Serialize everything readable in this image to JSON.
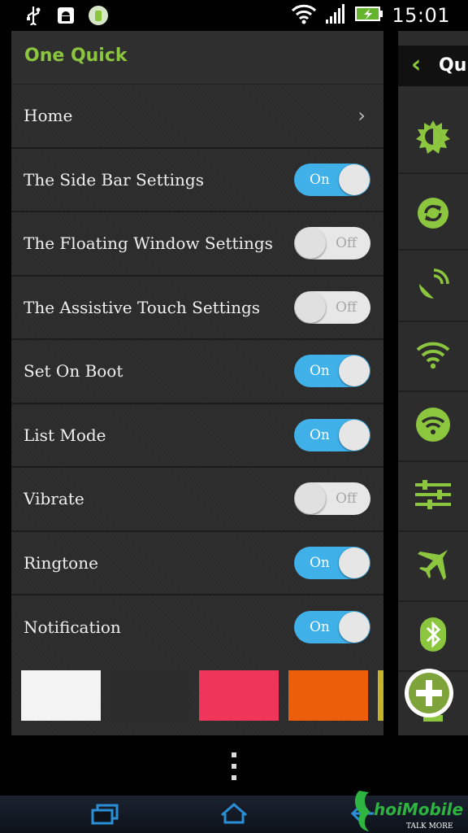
{
  "status_bar": {
    "time": "15:01",
    "icons": [
      "usb-icon",
      "android-debug-icon",
      "app-notification-icon",
      "wifi-icon",
      "signal-icon",
      "battery-charging-icon"
    ]
  },
  "app": {
    "title": "One Quick"
  },
  "menu": {
    "home_label": "Home",
    "items": [
      {
        "label": "The Side Bar Settings",
        "state": "On"
      },
      {
        "label": "The Floating Window Settings",
        "state": "Off"
      },
      {
        "label": "The Assistive Touch Settings",
        "state": "Off"
      },
      {
        "label": "Set On Boot",
        "state": "On"
      },
      {
        "label": "List Mode",
        "state": "On"
      },
      {
        "label": "Vibrate",
        "state": "Off"
      },
      {
        "label": "Ringtone",
        "state": "On"
      },
      {
        "label": "Notification",
        "state": "On"
      }
    ]
  },
  "swatches": [
    "#f3f3f3",
    "#2c2c2c",
    "#ef355a",
    "#ec5e0a",
    "#c7b528"
  ],
  "sidebar": {
    "header_text": "Qui",
    "items": [
      "brightness-icon",
      "sync-icon",
      "satellite-icon",
      "wifi-icon",
      "wifi-circle-icon",
      "equalizer-icon",
      "airplane-icon",
      "bluetooth-icon"
    ]
  },
  "colors": {
    "accent": "#8cc63f",
    "toggle_on": "#3fb0e8",
    "panel_bg": "#2c2c2c"
  },
  "watermark": {
    "brand": "hoiMobile",
    "tagline": "TALK MORE"
  }
}
